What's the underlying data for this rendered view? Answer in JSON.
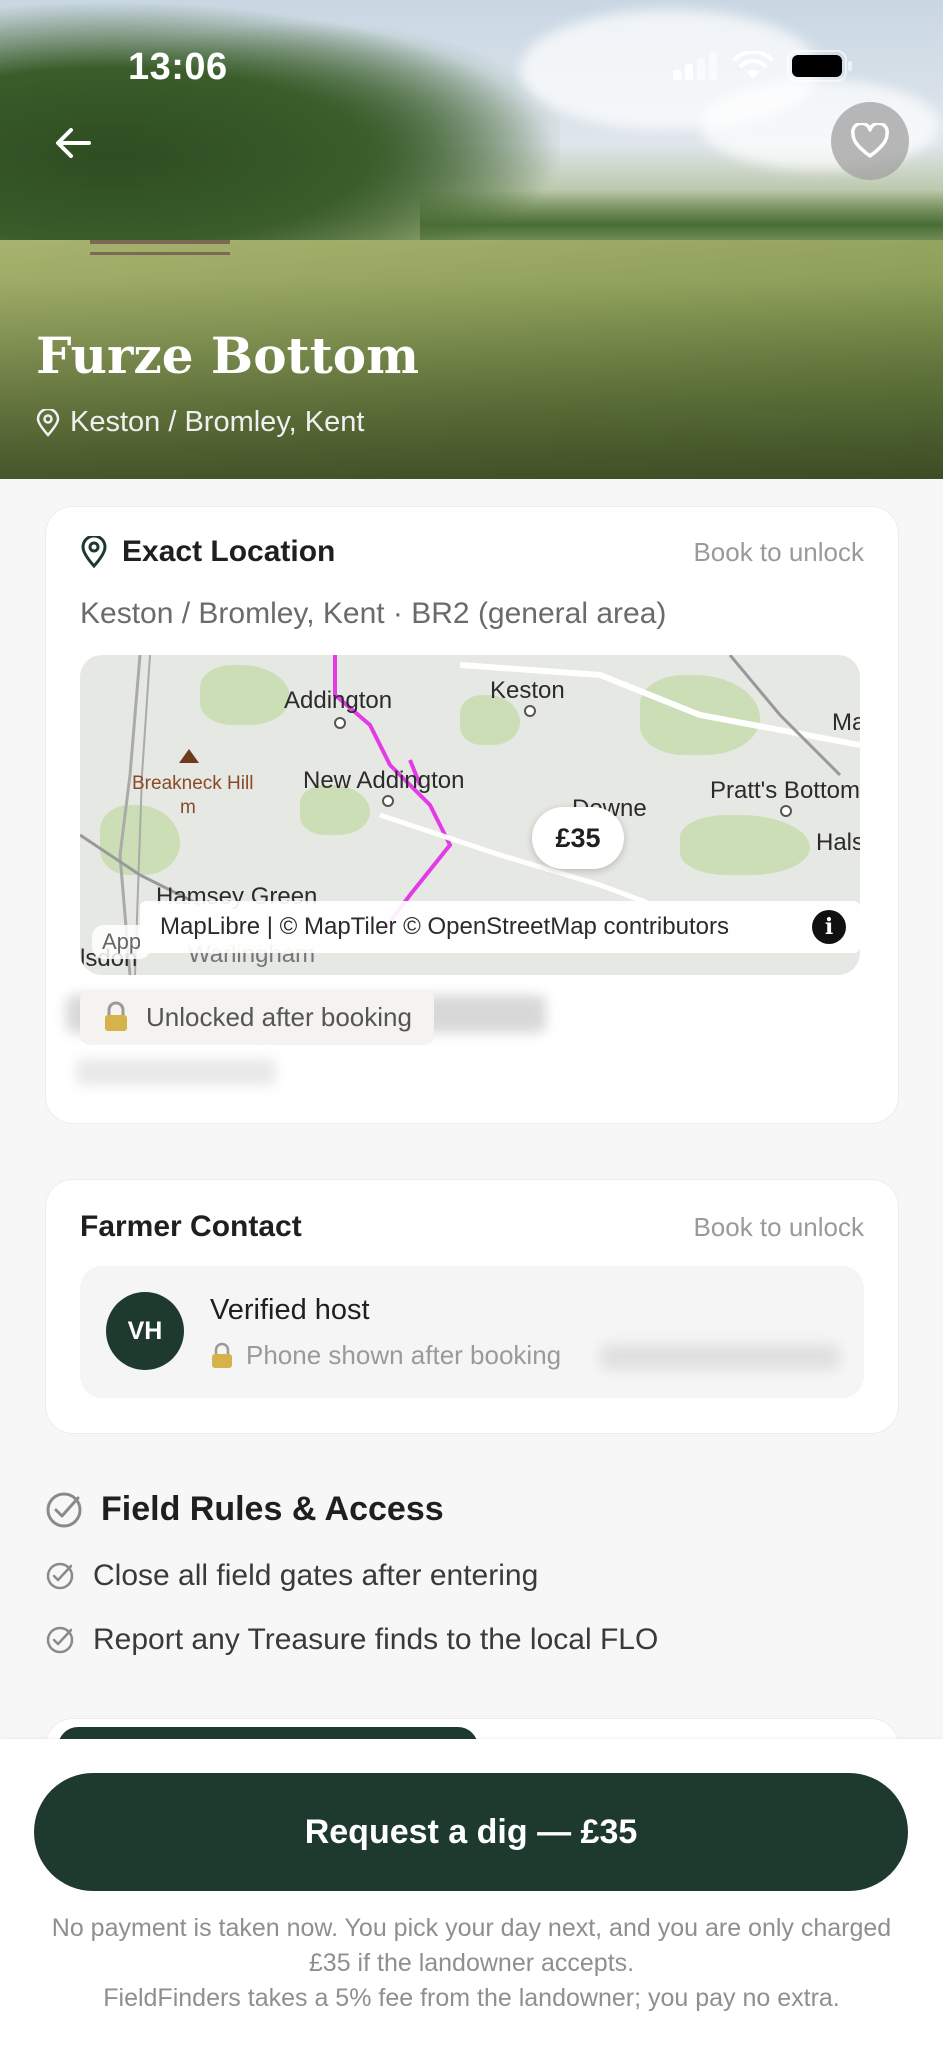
{
  "status_bar": {
    "time": "13:06"
  },
  "listing": {
    "title": "Furze Bottom",
    "location": "Keston / Bromley, Kent"
  },
  "exact_location": {
    "title": "Exact Location",
    "lock_text": "Book to unlock",
    "subtitle": "Keston / Bromley, Kent · BR2 (general area)",
    "map": {
      "labels": [
        "Addington",
        "Keston",
        "Ma",
        "Breakneck Hill",
        "m",
        "New Addington",
        "Pratt's Bottom",
        "Downe",
        "Hals",
        "Hamsey Green",
        "Warlingham",
        "lsdon"
      ],
      "price_pin": "£35",
      "attribution": "MapLibre | © MapTiler © OpenStreetMap contributors",
      "app_chip": "App"
    },
    "unlock_chip": "Unlocked after booking"
  },
  "farmer_contact": {
    "title": "Farmer Contact",
    "lock_text": "Book to unlock",
    "avatar_initials": "VH",
    "host_label": "Verified host",
    "phone_note": "Phone shown after booking"
  },
  "rules": {
    "title": "Field Rules & Access",
    "items": [
      "Close all field gates after entering",
      "Report any Treasure finds to the local FLO"
    ]
  },
  "footer": {
    "cta": "Request a dig — £35",
    "disclaimer_line1": "No payment is taken now. You pick your day next, and you are only charged £35 if the landowner accepts.",
    "disclaimer_line2": "FieldFinders takes a 5% fee from the landowner; you pay no extra."
  },
  "colors": {
    "primary": "#1e3a2f",
    "muted": "#9a9a9a"
  }
}
